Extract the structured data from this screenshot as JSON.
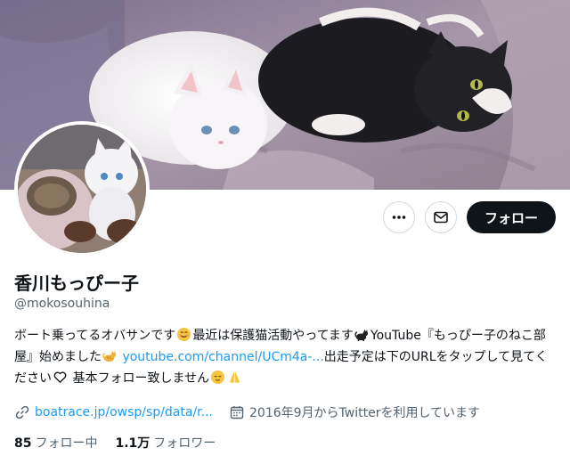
{
  "profile": {
    "name": "香川もっぴー子",
    "handle": "@mokosouhina"
  },
  "actions": {
    "more_icon": "more-horizontal-icon",
    "message_icon": "mail-icon",
    "follow_label": "フォロー"
  },
  "bio": {
    "part1": "ボート乗ってるオバサンです",
    "part2": "最近は保護猫活動やってます",
    "part3": "YouTube『もっぴー子のねこ部屋』始めました",
    "link": "youtube.com/channel/UCm4a-...",
    "part4": "出走予定は下のURLをタップして見てください",
    "part5": " 基本フォロー致しません",
    "emojis": [
      "smiling-face-emoji",
      "black-cat-emoji",
      "cat-emoji",
      "heart-outline-emoji",
      "relieved-face-emoji",
      "folded-hands-emoji"
    ]
  },
  "meta": {
    "website": "boatrace.jp/owsp/sp/data/r...",
    "joined": "2016年9月からTwitterを利用しています"
  },
  "stats": {
    "following_count": "85",
    "following_label": "フォロー中",
    "followers_count": "1.1万",
    "followers_label": "フォロワー"
  },
  "colors": {
    "link": "#1d9bf0",
    "text": "#0f1419",
    "secondary": "#536471",
    "button_dark": "#0f1419"
  }
}
